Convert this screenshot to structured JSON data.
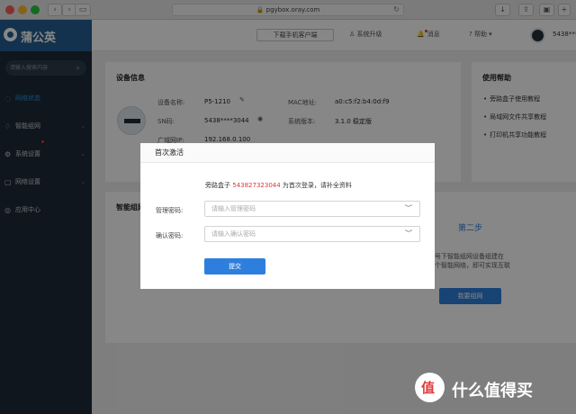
{
  "browser": {
    "url": "pgybox.oray.com",
    "back": "‹",
    "forward": "›"
  },
  "sidebar": {
    "logo": "蒲公英",
    "search_placeholder": "请输入搜索内容",
    "items": [
      {
        "label": "网络状态",
        "active": true
      },
      {
        "label": "智能组网"
      },
      {
        "label": "系统设置",
        "badge": true
      },
      {
        "label": "网络设置"
      },
      {
        "label": "应用中心"
      }
    ]
  },
  "topbar": {
    "download": "下载手机客户端",
    "upgrade": "系统升级",
    "messages": "消息",
    "help": "帮助",
    "user": "5438***"
  },
  "device": {
    "title": "设备信息",
    "name_label": "设备名称:",
    "name_value": "P5-1210",
    "sn_label": "SN码:",
    "sn_value": "5438****3044",
    "wan_label": "广域网IP:",
    "wan_value": "192.168.0.100",
    "mac_label": "MAC地址:",
    "mac_value": "a0:c5:f2:b4:0d:f9",
    "version_label": "系统版本:",
    "version_value": "3.1.0 稳定版"
  },
  "help_card": {
    "title": "使用帮助",
    "links": [
      "旁路盒子使用教程",
      "局域网文件共享教程",
      "打印机共享功能教程"
    ]
  },
  "network": {
    "title": "智能组网",
    "step2": "第二步",
    "desc_line1": "号下智能组网设备组建在",
    "desc_line2": "个智能网络，即可实现互联",
    "button": "我要组网"
  },
  "modal": {
    "title": "首次激活",
    "intro_prefix": "旁路盒子 ",
    "intro_sn": "543827323044",
    "intro_suffix": " 为首次登录，请补全资料",
    "password_label": "管理密码:",
    "password_placeholder": "请输入管理密码",
    "confirm_label": "确认密码:",
    "confirm_placeholder": "请输入确认密码",
    "submit": "提交"
  },
  "watermark": {
    "text": "什么值得买"
  }
}
